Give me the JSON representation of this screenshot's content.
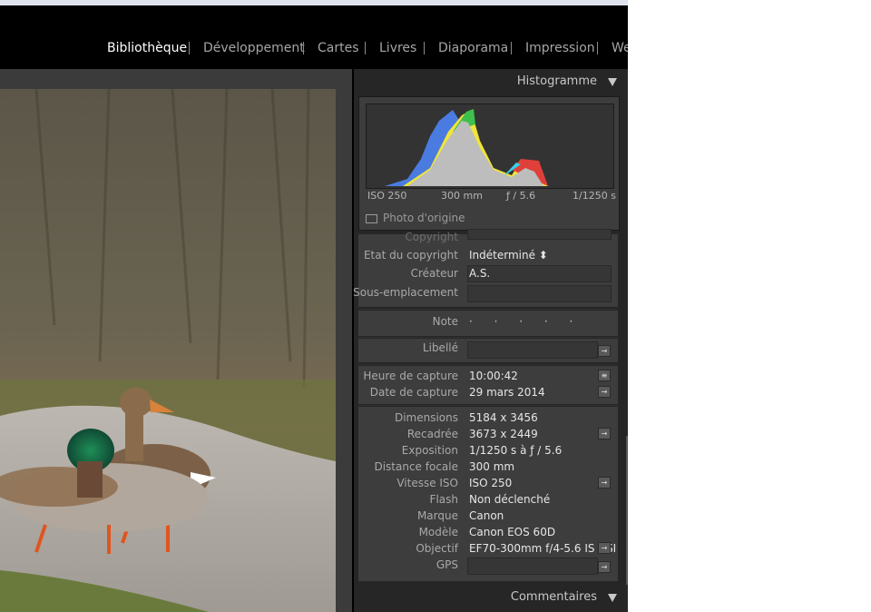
{
  "modules": [
    "Bibliothèque",
    "Développement",
    "Cartes",
    "Livres",
    "Diaporama",
    "Impression",
    "We"
  ],
  "histogram": {
    "title": "Histogramme",
    "iso": "ISO 250",
    "focal": "300 mm",
    "aperture": "ƒ / 5.6",
    "shutter": "1/1250 s",
    "original_label": "Photo d'origine"
  },
  "metadata": {
    "copyright_partial": "Copyright",
    "copyright_status": {
      "label": "Etat du copyright",
      "value": "Indéterminé ⬍"
    },
    "creator": {
      "label": "Créateur",
      "value": "A.S."
    },
    "sublocation": {
      "label": "Sous-emplacement",
      "value": ""
    },
    "rating": {
      "label": "Note",
      "value": "· · · · ·"
    },
    "label": {
      "label": "Libellé",
      "value": ""
    },
    "capture_time": {
      "label": "Heure de capture",
      "value": "10:00:42"
    },
    "capture_date": {
      "label": "Date de capture",
      "value": "29 mars 2014"
    },
    "dimensions": {
      "label": "Dimensions",
      "value": "5184 x 3456"
    },
    "cropped": {
      "label": "Recadrée",
      "value": "3673 x 2449"
    },
    "exposure": {
      "label": "Exposition",
      "value": "1/1250 s à ƒ / 5.6"
    },
    "focal_length": {
      "label": "Distance focale",
      "value": "300 mm"
    },
    "iso_speed": {
      "label": "Vitesse ISO",
      "value": "ISO 250"
    },
    "flash": {
      "label": "Flash",
      "value": "Non déclenché"
    },
    "make": {
      "label": "Marque",
      "value": "Canon"
    },
    "model": {
      "label": "Modèle",
      "value": "Canon EOS 60D"
    },
    "lens": {
      "label": "Objectif",
      "value": "EF70-300mm f/4-5.6 IS USI"
    },
    "gps": {
      "label": "GPS",
      "value": ""
    }
  },
  "comments": {
    "title": "Commentaires"
  },
  "colors": {
    "panel": "#3d3d3d",
    "background": "#000000",
    "active_module": "#ffffff"
  },
  "icons": [
    "collapse-triangle-icon",
    "arrow-go-icon",
    "list-icon",
    "checkbox-icon"
  ]
}
